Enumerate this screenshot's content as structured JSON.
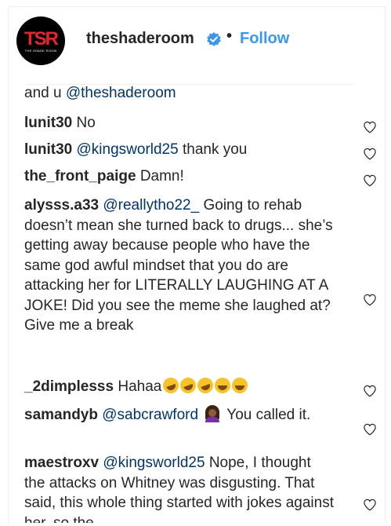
{
  "header": {
    "avatar_logo": "TSR",
    "avatar_logo_sub": "THE SHADE ROOM",
    "username": "theshaderoom",
    "dot": "•",
    "follow_label": "Follow",
    "verified_icon": "verified-badge-icon",
    "brand_color": "#3897f0"
  },
  "comments": [
    {
      "user": "",
      "mention": "@theshaderoom",
      "prefix": "and u ",
      "text": ""
    },
    {
      "user": "lunit30",
      "mention": "",
      "prefix": "",
      "text": "No"
    },
    {
      "user": "lunit30",
      "mention": "@kingsworld25",
      "prefix": "",
      "text": "thank you"
    },
    {
      "user": "the_front_paige",
      "mention": "",
      "prefix": "",
      "text": "Damn!"
    },
    {
      "user": "alysss.a33",
      "mention": "@reallytho22_",
      "prefix": "",
      "text": "Going to rehab doesn’t mean she turned back to drugs... she’s getting away because people who have the same god awful mindset that you do are attacking her for LITERALLY LAUGHING AT A JOKE! Did you see the meme she laughed at? Give me a break"
    },
    {
      "user": "_2dimplesss",
      "mention": "",
      "prefix": "",
      "text": "Hahaa"
    },
    {
      "user": "samandyb",
      "mention": "@sabcrawford",
      "prefix": "",
      "text": "You called it."
    },
    {
      "user": "maestroxv",
      "mention": "@kingsworld25",
      "prefix": "",
      "text": "Nope, I thought the attacks on Whitney was disgusting. That said, this whole thing started with jokes against her, so the"
    }
  ],
  "icons": {
    "like": "heart-outline-icon",
    "laughing_emoji": "rolling-on-floor-laughing-emoji",
    "joy_emoji": "face-with-tears-of-joy-emoji",
    "person_emoji": "woman-tipping-hand-emoji"
  }
}
